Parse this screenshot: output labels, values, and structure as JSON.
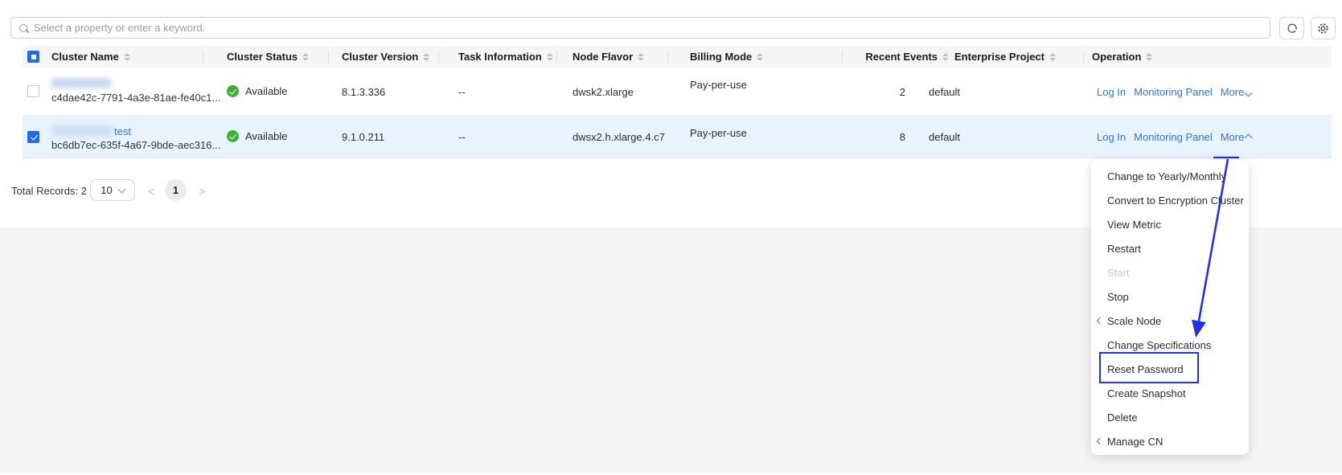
{
  "search": {
    "placeholder": "Select a property or enter a keyword."
  },
  "toolbar": {
    "refresh_icon": "refresh-icon",
    "settings_icon": "gear-icon"
  },
  "table": {
    "columns": [
      {
        "label": "Cluster Name"
      },
      {
        "label": "Cluster Status"
      },
      {
        "label": "Cluster Version"
      },
      {
        "label": "Task Information"
      },
      {
        "label": "Node Flavor"
      },
      {
        "label": "Billing Mode"
      },
      {
        "label": "Recent Events"
      },
      {
        "label": "Enterprise Project"
      },
      {
        "label": "Operation"
      }
    ],
    "rows": [
      {
        "name_visible_part": "",
        "name_redacted": true,
        "cluster_id": "c4dae42c-7791-4a3e-81ae-fe40c1...",
        "status": "Available",
        "version": "8.1.3.336",
        "task_info": "--",
        "node_flavor": "dwsk2.xlarge",
        "billing_mode": "Pay-per-use",
        "recent_events": "2",
        "enterprise_project": "default",
        "op_login": "Log In",
        "op_monitoring": "Monitoring Panel",
        "op_more": "More",
        "more_state": "collapsed",
        "selected": false
      },
      {
        "name_visible_part": "test",
        "name_redacted": true,
        "cluster_id": "bc6db7ec-635f-4a67-9bde-aec316...",
        "status": "Available",
        "version": "9.1.0.211",
        "task_info": "--",
        "node_flavor": "dwsx2.h.xlarge.4.c7",
        "billing_mode": "Pay-per-use",
        "recent_events": "8",
        "enterprise_project": "default",
        "op_login": "Log In",
        "op_monitoring": "Monitoring Panel",
        "op_more": "More",
        "more_state": "expanded",
        "selected": true
      }
    ]
  },
  "pagination": {
    "total_label": "Total Records:",
    "total_value": "2",
    "page_size": "10",
    "current_page": "1",
    "prev": "<",
    "next": ">"
  },
  "more_menu": {
    "items": [
      {
        "label": "Change to Yearly/Monthly"
      },
      {
        "label": "Convert to Encryption Cluster"
      },
      {
        "label": "View Metric"
      },
      {
        "label": "Restart"
      },
      {
        "label": "Start",
        "disabled": true
      },
      {
        "label": "Stop"
      },
      {
        "label": "Scale Node",
        "has_submenu": true
      },
      {
        "label": "Change Specifications"
      },
      {
        "label": "Reset Password",
        "highlighted": true
      },
      {
        "label": "Create Snapshot"
      },
      {
        "label": "Delete"
      },
      {
        "label": "Manage CN",
        "has_submenu": true
      }
    ]
  },
  "annotation": {
    "highlight_target": "Reset Password",
    "arrow_color": "#2331e3"
  },
  "colors": {
    "link": "#2d72ee",
    "status_available": "#3cb034",
    "selected_row_bg": "#e9f3fd",
    "header_bg": "#f5f5f5",
    "page_bg": "#f4f4f5",
    "checkbox_accent": "#2468e4",
    "annotation_blue": "#2331e3"
  }
}
